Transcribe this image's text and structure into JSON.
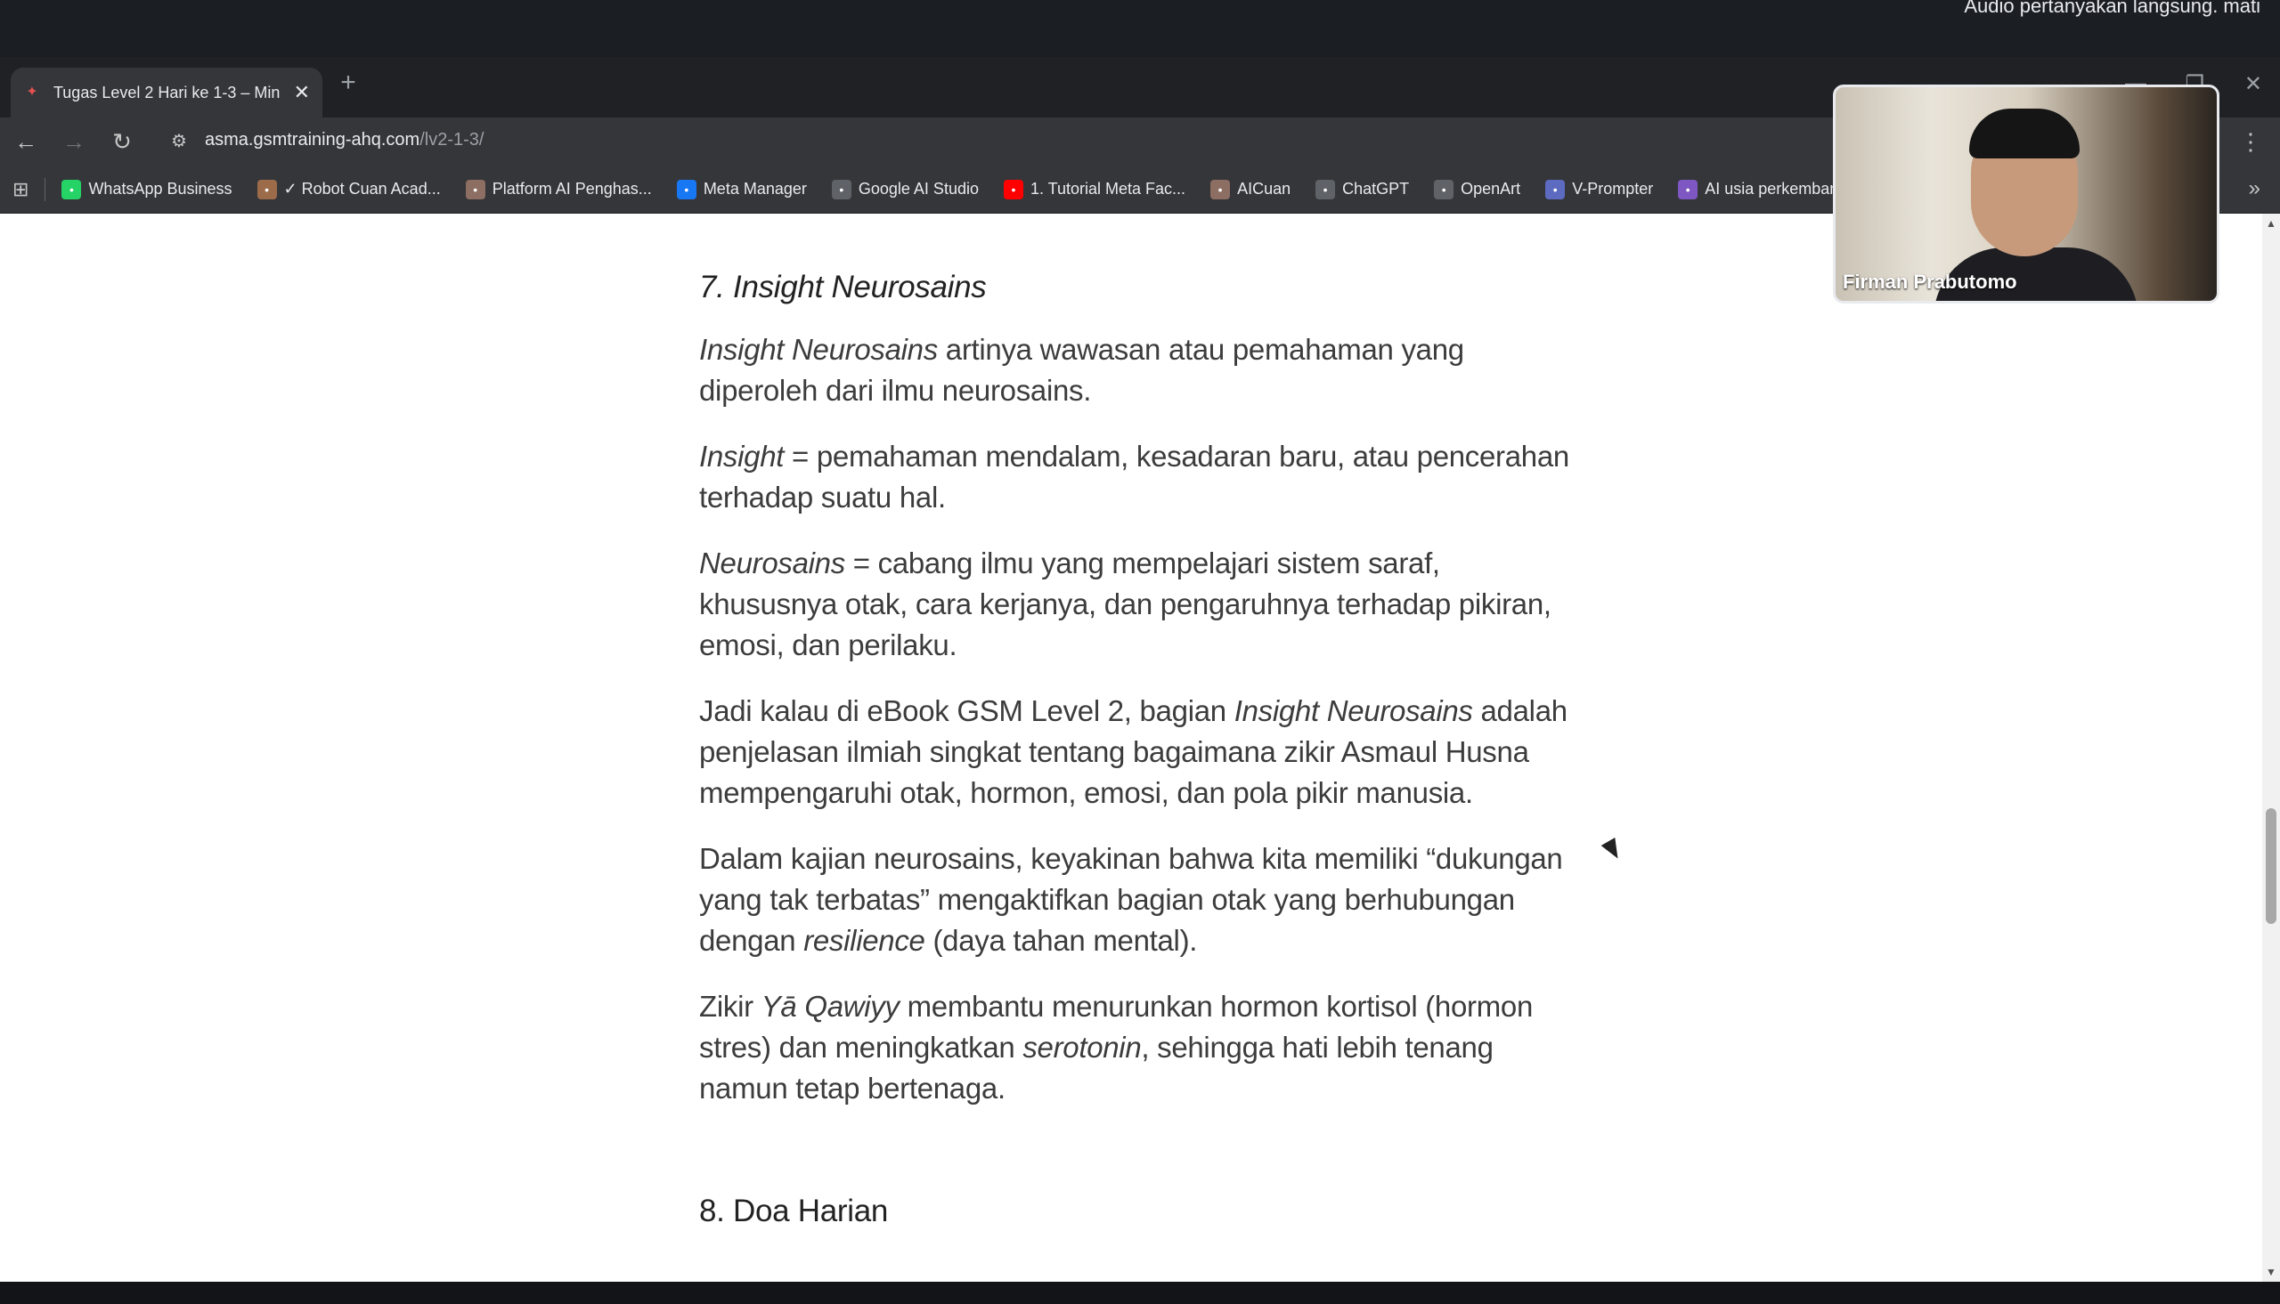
{
  "meeting": {
    "notice": "Audio pertanyakan langsung. mati",
    "participant_name": "Firman Prabutomo"
  },
  "browser": {
    "tab_title": "Tugas Level 2 Hari ke 1-3 – Min",
    "url_host": "asma.gsmtraining-ahq.com",
    "url_path": "/lv2-1-3/",
    "bookmarks": [
      {
        "label": "WhatsApp Business",
        "icon": "whatsapp-icon",
        "color": "#25d366"
      },
      {
        "label": "✓ Robot Cuan Acad...",
        "icon": "robot-icon",
        "color": "#9c6b4a"
      },
      {
        "label": "Platform AI Penghas...",
        "icon": "platform-icon",
        "color": "#8d6e63"
      },
      {
        "label": "Meta Manager",
        "icon": "meta-icon",
        "color": "#1877f2"
      },
      {
        "label": "Google AI Studio",
        "icon": "studio-icon",
        "color": "#5f6368"
      },
      {
        "label": "1. Tutorial Meta Fac...",
        "icon": "youtube-icon",
        "color": "#ff0000"
      },
      {
        "label": "AICuan",
        "icon": "aicuan-icon",
        "color": "#8d6e63"
      },
      {
        "label": "ChatGPT",
        "icon": "chatgpt-icon",
        "color": "#5f6368"
      },
      {
        "label": "OpenArt",
        "icon": "openart-icon",
        "color": "#5f6368"
      },
      {
        "label": "V-Prompter",
        "icon": "vprompter-icon",
        "color": "#5c6bc0"
      },
      {
        "label": "AI usia perkembang",
        "icon": "ai-icon",
        "color": "#7e57c2"
      }
    ]
  },
  "article": {
    "section7_heading": "7. Insight Neurosains",
    "p1_em": "Insight Neurosains",
    "p1_text": " artinya wawasan atau pemahaman yang diperoleh dari ilmu neurosains.",
    "p2_em": "Insight",
    "p2_text": " = pemahaman mendalam, kesadaran baru, atau pencerahan terhadap suatu hal.",
    "p3_em": "Neurosains",
    "p3_text": " = cabang ilmu yang mempelajari sistem saraf, khususnya otak, cara kerjanya, dan pengaruhnya terhadap pikiran, emosi, dan perilaku.",
    "p4_a": "Jadi kalau di eBook GSM Level 2, bagian ",
    "p4_em": "Insight Neurosains",
    "p4_b": " adalah penjelasan ilmiah singkat tentang bagaimana zikir Asmaul Husna mempengaruhi otak, hormon, emosi, dan pola pikir manusia.",
    "p5_a": "Dalam kajian neurosains, keyakinan bahwa kita memiliki “dukungan yang tak terbatas” mengaktifkan bagian otak yang berhubungan dengan ",
    "p5_em": "resilience",
    "p5_b": " (daya tahan mental).",
    "p6_a": "Zikir ",
    "p6_em1": "Yā Qawiyy",
    "p6_b": " membantu menurunkan hormon kortisol (hormon stres) dan meningkatkan ",
    "p6_em2": "serotonin",
    "p6_c": ", sehingga hati lebih tenang namun tetap bertenaga.",
    "section8_heading": "8. Doa Harian"
  }
}
